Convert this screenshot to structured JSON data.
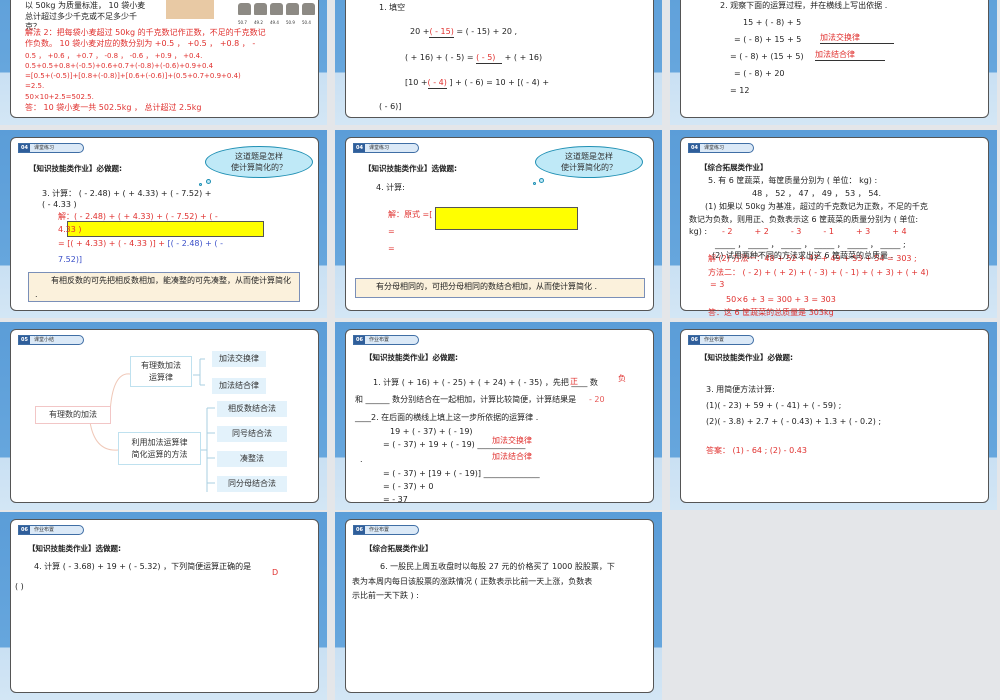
{
  "slides": [
    {
      "lines": [
        "以 50kg 为质量标准， 10 袋小麦",
        "总计超过多少千克或不足多少千",
        "克？"
      ],
      "sack_labels": [
        "50.7",
        "49.2",
        "49.4",
        "50.9",
        "50.4"
      ],
      "red": [
        "解法 2：把每袋小麦超过 50kg 的千克数记作正数，不足的千克数记",
        "作负数。 10 袋小麦对应的数分别为 +0.5 ， +0.5 ， +0.8 ， -",
        "0.5 ， +0.6 ， +0.7 ， -0.8 ， -0.6 ， +0.9 ， +0.4.",
        "0.5+0.5+0.8+(-0.5)+0.6+0.7+(-0.8)+(-0.6)+0.9+0.4",
        "=[0.5+(-0.5)]+[0.8+(-0.8)]+[0.6+(-0.6)]+(0.5+0.7+0.9+0.4)",
        "=2.5.",
        "50×10+2.5=502.5.",
        "答： 10 袋小麦一共 502.5kg ， 总计超过 2.5kg"
      ]
    },
    {
      "title": "1. 填空",
      "l1a": "20 +",
      "l1r": "( - 15)",
      "l1b": " = ( - 15) + 20 ,",
      "l2a": "( + 16) + ( - 5) =",
      "l2r": "( - 5)",
      "l2b": "  + ( + 16)",
      "l3a": "[10 +",
      "l3r": "( - 4)",
      "l3b": " ] + ( - 6) = 10 + [( - 4) +",
      "l4": "( - 6)]"
    },
    {
      "title": "2. 观察下面的运算过程，并在横线上写出依据 .",
      "lines": [
        "15 + ( - 8) + 5",
        "= ( - 8) + 15 + 5",
        "= ( - 8) + (15 + 5)",
        "= ( - 8) + 20",
        "= 12"
      ],
      "r1": "加法交换律",
      "r2": "加法结合律"
    },
    {
      "tag_num": "04",
      "tag": "课堂练习",
      "heading": "【知识技能类作业】必做题:",
      "cloud": [
        "这道题是怎样",
        "使计算简化的？"
      ],
      "q": [
        "3. 计算： ( - 2.48) + ( + 4.33) + ( - 7.52) +",
        "( - 4.33 )"
      ],
      "s1": "解：( - 2.48) + ( + 4.33) + ( - 7.52) + ( -",
      "s2": "4.33 )",
      "s3r": "= [( + 4.33) + ( - 4.33 )] + ",
      "s3b": "[( - 2.48) + ( -",
      "s4": "7.52)]",
      "note": "有相反数的可先把相反数相加，能凑整的可先凑整，从而使计算简化 ."
    },
    {
      "tag_num": "04",
      "tag": "课堂练习",
      "heading": "【知识技能类作业】选做题:",
      "cloud": [
        "这道题是怎样",
        "使计算简化的？"
      ],
      "q": "4. 计算:",
      "s1": "解：原式 =[",
      "eq": "=",
      "note": "有分母相同的，可把分母相同的数结合相加，从而使计算简化 ."
    },
    {
      "tag_num": "04",
      "tag": "课堂练习",
      "heading": "【综合拓展类作业】",
      "lines": [
        "5. 有 6 筐蔬菜，每筐质量分别为 ( 单位： kg) :",
        "48 ， 52 ， 47 ， 49 ， 53 ， 54.",
        "(1) 如果以 50kg 为基准，超过的千克数记为正数，不足的千克",
        "数记为负数，则用正、负数表示这 6 筐蔬菜的质量分别为 ( 单位:",
        "kg) :",
        "_____ ， _____ ， _____ ， _____ ， _____ ， _____ ;",
        "(2) 试用两种不同的方法求出这 6 筐蔬菜的总质量 ."
      ],
      "vals": [
        "- 2",
        "+ 2",
        "- 3",
        "- 1",
        "+ 3",
        "+ 4"
      ],
      "red": [
        "解 (2) 方法一：48 + 52 + 47 + 49 + 53 + 54 = 303 ;",
        "方法二： ( - 2) + ( + 2) + ( - 3) + ( - 1) + ( + 3) + ( + 4)",
        "= 3",
        "50×6  + 3  = 300 + 3 = 303",
        "答：这 6 筐蔬菜的总质量是 303kg"
      ]
    },
    {
      "tag_num": "05",
      "tag": "课堂小结",
      "root": "有理数的加法",
      "b1": [
        "有理数加法",
        "运算律"
      ],
      "b1_leaves": [
        "加法交换律",
        "加法结合律"
      ],
      "b2": [
        "利用加法运算律",
        "简化运算的方法"
      ],
      "b2_leaves": [
        "相反数结合法",
        "同号结合法",
        "凑整法",
        "同分母结合法"
      ]
    },
    {
      "tag_num": "06",
      "tag": "作业布置",
      "heading": "【知识技能类作业】必做题:",
      "l1": "1. 计算 ( + 16) + ( - 25) + ( + 24) + ( - 35) ，先把 ____ 数",
      "r_zheng": "正",
      "r_fu": "负",
      "l2": "和 ______ 数分别结合在一起相加，计算比较简便，计算结果是",
      "r_res": "- 20",
      "l3": "____2. 在后面的横线上填上这一步所依据的运算律 .",
      "lines": [
        "19 + ( - 37) + ( - 19)",
        "= ( - 37) + 19 + ( - 19) ____________",
        "= ( - 37) + [19 + ( - 19)] ______________",
        "= ( - 37) + 0",
        "= - 37"
      ],
      "r1": "加法交换律",
      "r2": "加法结合律",
      "dot": "."
    },
    {
      "tag_num": "06",
      "tag": "作业布置",
      "heading": "【知识技能类作业】必做题:",
      "lines": [
        "3.  用简便方法计算:",
        "(1)( - 23) + 59 + ( - 41) + ( - 59) ;",
        "(2)( - 3.8) + 2.7 + ( - 0.43) + 1.3 + ( - 0.2) ;"
      ],
      "answer": "答案： (1) - 64 ; (2) - 0.43"
    },
    {
      "tag_num": "06",
      "tag": "作业布置",
      "heading": "【知识技能类作业】选做题:",
      "q": "4. 计算 ( - 3.68) + 19 + ( - 5.32) ，下列简便运算正确的是",
      "ans": "D",
      "paren": "(      )"
    },
    {
      "tag_num": "06",
      "tag": "作业布置",
      "heading": "【综合拓展类作业】",
      "lines": [
        "6. 一股民上周五收盘时以每股 27 元的价格买了 1000 股股票，下",
        "表为本周内每日该股票的涨跌情况 ( 正数表示比前一天上涨，负数表",
        "示比前一天下跌 ) :"
      ]
    }
  ]
}
